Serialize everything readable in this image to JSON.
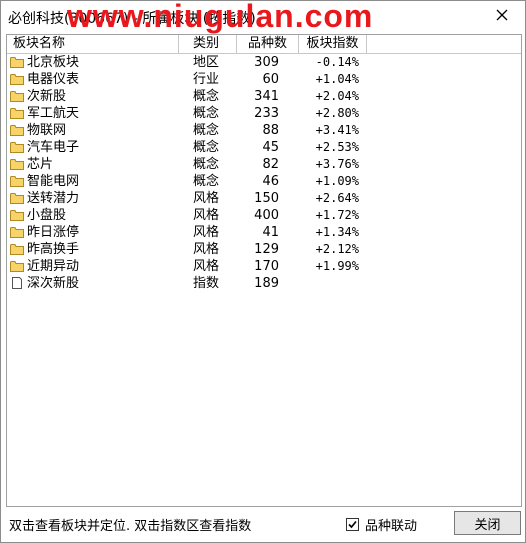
{
  "window": {
    "title": "必创科技(300667) - 所属板块 (按指数)",
    "watermark": "www.niugulan.com"
  },
  "list": {
    "columns": [
      {
        "label": "板块名称"
      },
      {
        "label": "类别"
      },
      {
        "label": "品种数"
      },
      {
        "label": "板块指数"
      }
    ],
    "rows": [
      {
        "name": "北京板块",
        "type": "地区",
        "count": "309",
        "index": "-0.14%",
        "icon": "folder-icon"
      },
      {
        "name": "电器仪表",
        "type": "行业",
        "count": "60",
        "index": "+1.04%",
        "icon": "folder-icon"
      },
      {
        "name": "次新股",
        "type": "概念",
        "count": "341",
        "index": "+2.04%",
        "icon": "folder-icon"
      },
      {
        "name": "军工航天",
        "type": "概念",
        "count": "233",
        "index": "+2.80%",
        "icon": "folder-icon"
      },
      {
        "name": "物联网",
        "type": "概念",
        "count": "88",
        "index": "+3.41%",
        "icon": "folder-icon"
      },
      {
        "name": "汽车电子",
        "type": "概念",
        "count": "45",
        "index": "+2.53%",
        "icon": "folder-icon"
      },
      {
        "name": "芯片",
        "type": "概念",
        "count": "82",
        "index": "+3.76%",
        "icon": "folder-icon"
      },
      {
        "name": "智能电网",
        "type": "概念",
        "count": "46",
        "index": "+1.09%",
        "icon": "folder-icon"
      },
      {
        "name": "送转潜力",
        "type": "风格",
        "count": "150",
        "index": "+2.64%",
        "icon": "folder-icon"
      },
      {
        "name": "小盘股",
        "type": "风格",
        "count": "400",
        "index": "+1.72%",
        "icon": "folder-icon"
      },
      {
        "name": "昨日涨停",
        "type": "风格",
        "count": "41",
        "index": "+1.34%",
        "icon": "folder-icon"
      },
      {
        "name": "昨高换手",
        "type": "风格",
        "count": "129",
        "index": "+2.12%",
        "icon": "folder-icon"
      },
      {
        "name": "近期异动",
        "type": "风格",
        "count": "170",
        "index": "+1.99%",
        "icon": "folder-icon"
      },
      {
        "name": "深次新股",
        "type": "指数",
        "count": "189",
        "index": "",
        "icon": "document-icon"
      }
    ]
  },
  "footer": {
    "hint": "双击查看板块并定位. 双击指数区查看指数",
    "checkbox_label": "品种联动",
    "checkbox_checked": true,
    "close_label": "关闭"
  }
}
